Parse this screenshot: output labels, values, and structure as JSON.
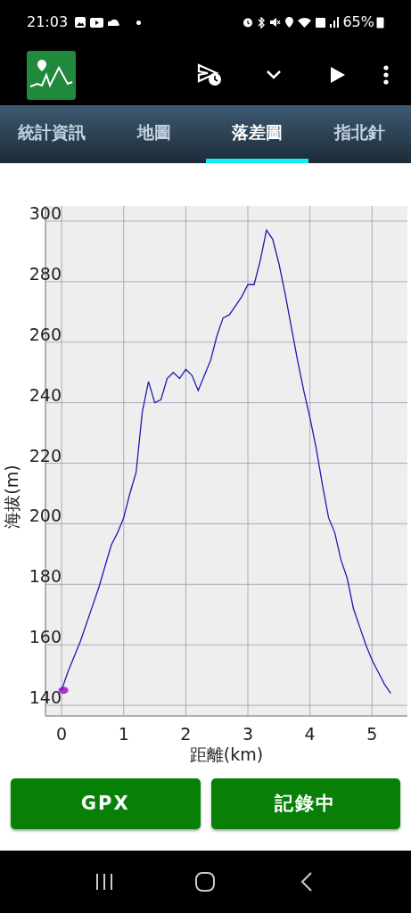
{
  "status_bar": {
    "time": "21:03",
    "battery": "65%"
  },
  "tabs": [
    {
      "label": "統計資訊",
      "selected": false
    },
    {
      "label": "地圖",
      "selected": false
    },
    {
      "label": "落差圖",
      "selected": true
    },
    {
      "label": "指北針",
      "selected": false
    }
  ],
  "elevation_chart": {
    "chart_data": {
      "type": "line",
      "xlabel": "距離(km)",
      "ylabel": "海拔(m)",
      "x": [
        0,
        0.1,
        0.2,
        0.3,
        0.4,
        0.5,
        0.6,
        0.7,
        0.8,
        0.9,
        1.0,
        1.1,
        1.2,
        1.3,
        1.4,
        1.5,
        1.6,
        1.7,
        1.8,
        1.9,
        2.0,
        2.1,
        2.2,
        2.3,
        2.4,
        2.5,
        2.6,
        2.7,
        2.8,
        2.9,
        3.0,
        3.1,
        3.2,
        3.3,
        3.4,
        3.5,
        3.6,
        3.7,
        3.8,
        3.9,
        4.0,
        4.1,
        4.2,
        4.3,
        4.4,
        4.5,
        4.6,
        4.7,
        4.8,
        4.9,
        5.0,
        5.1,
        5.2,
        5.3
      ],
      "series": [
        {
          "color": "#1c1cb0",
          "values": [
            145,
            151,
            156,
            161,
            167,
            173,
            179,
            186,
            193,
            197,
            202,
            210,
            217,
            237,
            247,
            240,
            241,
            248,
            250,
            248,
            251,
            249,
            244,
            249,
            254,
            262,
            268,
            269,
            272,
            275,
            279,
            279,
            287,
            297,
            294,
            286,
            276,
            265,
            254,
            244,
            235,
            225,
            213,
            202,
            197,
            188,
            182,
            172,
            166,
            160,
            155,
            151,
            147,
            144
          ]
        }
      ],
      "xlim": [
        -0.26,
        5.57
      ],
      "ylim": [
        136.5,
        305
      ],
      "xticks": [
        0,
        1,
        2,
        3,
        4,
        5
      ],
      "yticks": [
        140,
        160,
        180,
        200,
        220,
        240,
        260,
        280,
        300
      ],
      "grid": true
    }
  },
  "buttons": [
    {
      "label": "GPX"
    },
    {
      "label": "記錄中"
    }
  ]
}
